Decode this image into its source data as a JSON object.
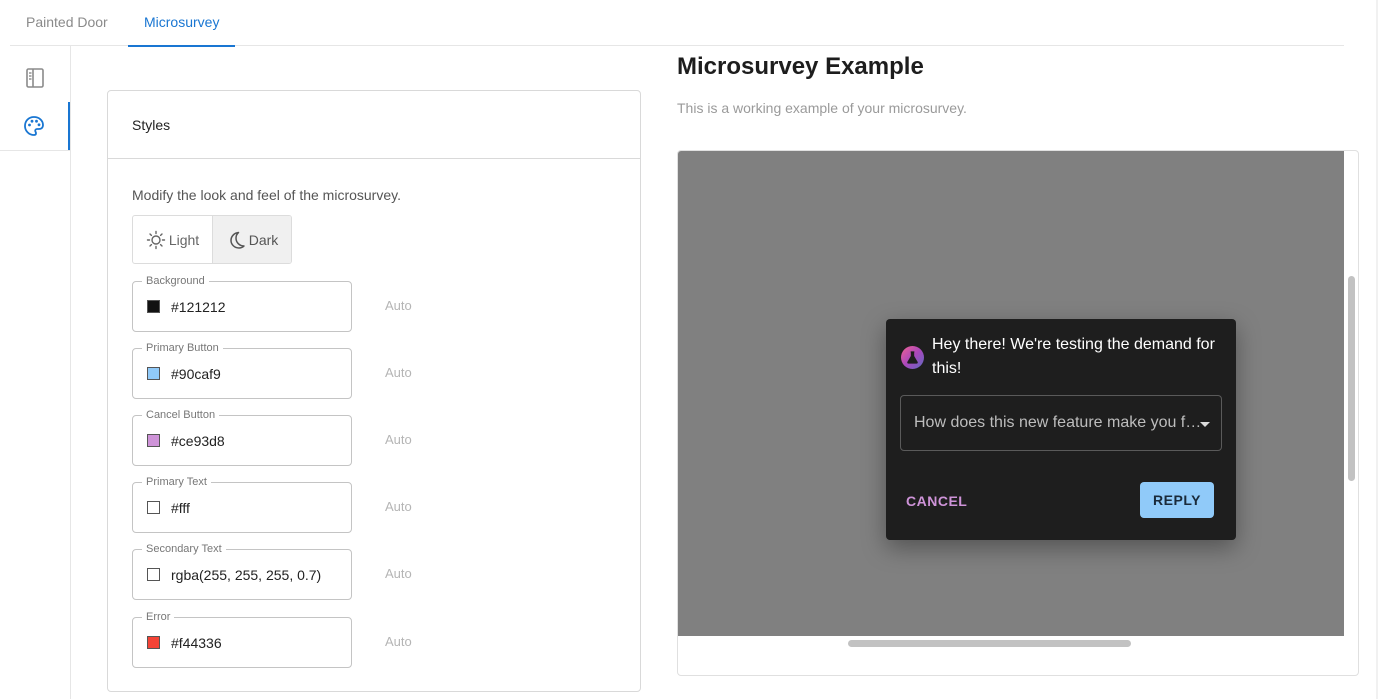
{
  "tabs": [
    {
      "label": "Painted Door",
      "active": false
    },
    {
      "label": "Microsurvey",
      "active": true
    }
  ],
  "sidebar": {
    "items": [
      {
        "icon": "layout-icon",
        "active": false
      },
      {
        "icon": "palette-icon",
        "active": true
      }
    ]
  },
  "styles_card": {
    "title": "Styles",
    "description": "Modify the look and feel of the microsurvey.",
    "mode_toggle": {
      "light_label": "Light",
      "dark_label": "Dark",
      "selected": "Dark"
    },
    "fields": [
      {
        "label": "Background",
        "value": "#121212",
        "swatch": "#121212",
        "auto_label": "Auto"
      },
      {
        "label": "Primary Button",
        "value": "#90caf9",
        "swatch": "#90caf9",
        "auto_label": "Auto"
      },
      {
        "label": "Cancel Button",
        "value": "#ce93d8",
        "swatch": "#ce93d8",
        "auto_label": "Auto"
      },
      {
        "label": "Primary Text",
        "value": "#fff",
        "swatch": "#ffffff",
        "auto_label": "Auto"
      },
      {
        "label": "Secondary Text",
        "value": "rgba(255, 255, 255, 0.7)",
        "swatch": "#ffffff",
        "auto_label": "Auto"
      },
      {
        "label": "Error",
        "value": "#f44336",
        "swatch": "#f44336",
        "auto_label": "Auto"
      }
    ]
  },
  "example": {
    "title": "Microsurvey Example",
    "subtitle": "This is a working example of your microsurvey.",
    "dialog": {
      "title": "Hey there! We're testing the demand for this!",
      "select_value": "How does this new feature make you feel?",
      "cancel_label": "CANCEL",
      "reply_label": "REPLY"
    }
  },
  "colors": {
    "accent": "#1976d2",
    "preview_backdrop": "#808080",
    "dialog_background": "#1e1e1e"
  }
}
